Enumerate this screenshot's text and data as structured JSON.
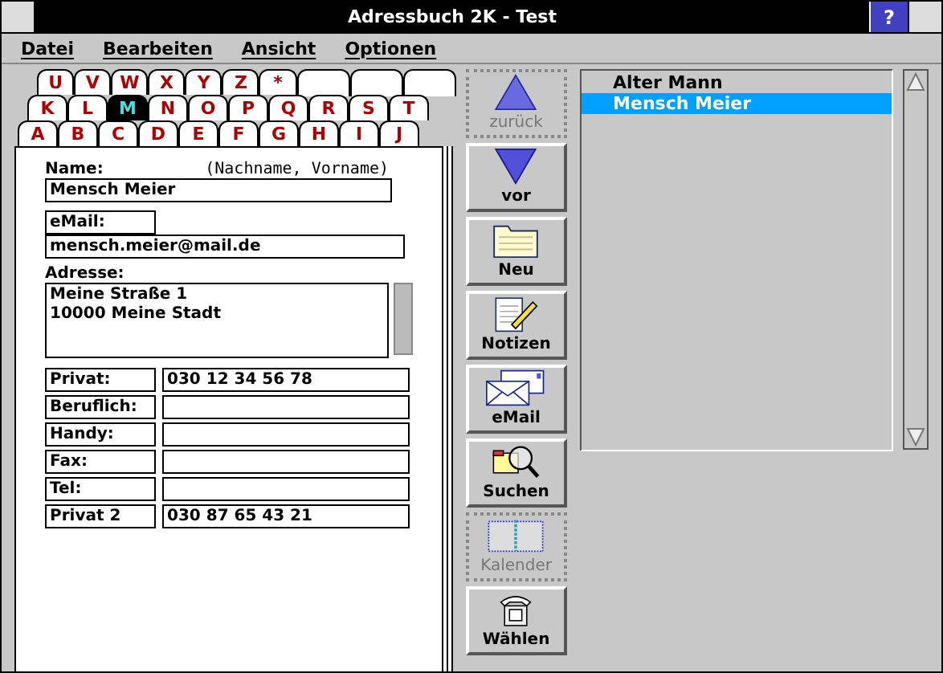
{
  "window": {
    "title": "Adressbuch 2K - Test",
    "help_button": "?"
  },
  "menu": [
    "Datei",
    "Bearbeiten",
    "Ansicht",
    "Optionen"
  ],
  "tab_rows": [
    [
      {
        "label": "U",
        "selected": false
      },
      {
        "label": "V",
        "selected": false
      },
      {
        "label": "W",
        "selected": false
      },
      {
        "label": "X",
        "selected": false
      },
      {
        "label": "Y",
        "selected": false
      },
      {
        "label": "Z",
        "selected": false
      },
      {
        "label": "*",
        "selected": false
      }
    ],
    [
      {
        "label": "K",
        "selected": false
      },
      {
        "label": "L",
        "selected": false
      },
      {
        "label": "M",
        "selected": true
      },
      {
        "label": "N",
        "selected": false
      },
      {
        "label": "O",
        "selected": false
      },
      {
        "label": "P",
        "selected": false
      },
      {
        "label": "Q",
        "selected": false
      },
      {
        "label": "R",
        "selected": false
      },
      {
        "label": "S",
        "selected": false
      },
      {
        "label": "T",
        "selected": false
      }
    ],
    [
      {
        "label": "A",
        "selected": false
      },
      {
        "label": "B",
        "selected": false
      },
      {
        "label": "C",
        "selected": false
      },
      {
        "label": "D",
        "selected": false
      },
      {
        "label": "E",
        "selected": false
      },
      {
        "label": "F",
        "selected": false
      },
      {
        "label": "G",
        "selected": false
      },
      {
        "label": "H",
        "selected": false
      },
      {
        "label": "I",
        "selected": false
      },
      {
        "label": "J",
        "selected": false
      }
    ]
  ],
  "form": {
    "name": {
      "label": "Name:",
      "hint": "(Nachname, Vorname)",
      "value": "Mensch Meier"
    },
    "email": {
      "label": "eMail:",
      "value": "mensch.meier@mail.de"
    },
    "address": {
      "label": "Adresse:",
      "lines": [
        "Meine Straße 1",
        "10000 Meine Stadt"
      ]
    },
    "phones": [
      {
        "label": "Privat:",
        "value": "030 12 34 56 78"
      },
      {
        "label": "Beruflich:"
      },
      {
        "label": "Handy:"
      },
      {
        "label": "Fax:"
      },
      {
        "label": "Tel:"
      },
      {
        "label": "Privat 2",
        "value": "030 87 65 43 21"
      }
    ]
  },
  "toolbar": [
    {
      "kind": "up",
      "label": "zurück",
      "disabled": true
    },
    {
      "kind": "down",
      "label": "vor",
      "disabled": false
    },
    {
      "kind": "folder",
      "label": "Neu",
      "disabled": false
    },
    {
      "kind": "notepad",
      "label": "Notizen",
      "disabled": false
    },
    {
      "kind": "envelope",
      "label": "eMail",
      "disabled": false
    },
    {
      "kind": "search",
      "label": "Suchen",
      "disabled": false
    },
    {
      "kind": "calendar",
      "label": "Kalender",
      "disabled": true
    },
    {
      "kind": "phone",
      "label": "Wählen",
      "disabled": false
    }
  ],
  "contacts": [
    {
      "name": "Alter Mann",
      "selected": false
    },
    {
      "name": "Mensch Meier",
      "selected": true
    }
  ]
}
